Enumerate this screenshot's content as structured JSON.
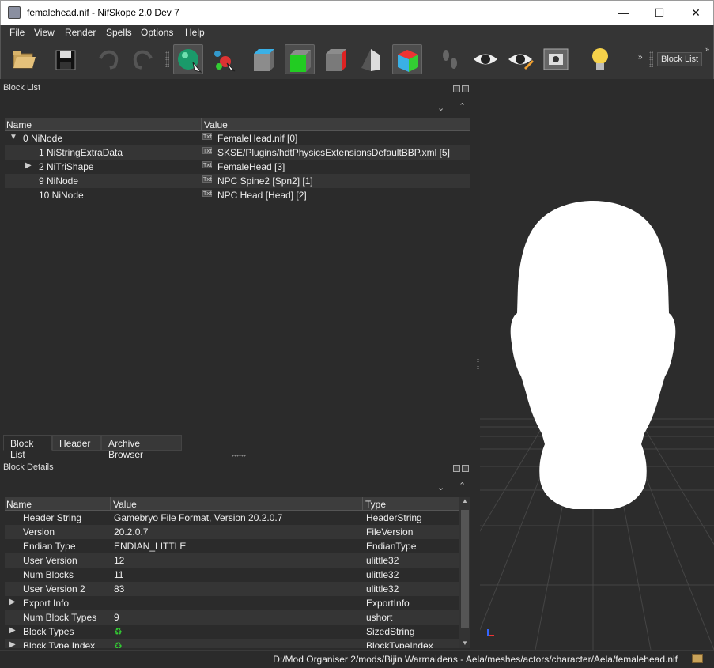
{
  "window": {
    "title": "femalehead.nif - NifSkope 2.0 Dev 7",
    "minimize_glyph": "—",
    "maximize_glyph": "☐",
    "close_glyph": "✕"
  },
  "menu": [
    "File",
    "View",
    "Render",
    "Spells",
    "Options",
    "Help"
  ],
  "toolbar": {
    "overflow_glyph": "»",
    "block_list_button": "Block List"
  },
  "block_list": {
    "title": "Block List",
    "columns": [
      "Name",
      "Value"
    ],
    "rows": [
      {
        "name": "0 NiNode",
        "value": "FemaleHead.nif [0]",
        "expander": "▼"
      },
      {
        "name": "1 NiStringExtraData",
        "value": "SKSE/Plugins/hdtPhysicsExtensionsDefaultBBP.xml [5]",
        "expander": ""
      },
      {
        "name": "2 NiTriShape",
        "value": "FemaleHead [3]",
        "expander": "▶"
      },
      {
        "name": "9 NiNode",
        "value": "NPC Spine2 [Spn2] [1]",
        "expander": ""
      },
      {
        "name": "10 NiNode",
        "value": "NPC Head [Head] [2]",
        "expander": ""
      }
    ],
    "value_icon": "Txt"
  },
  "tabs": [
    "Block List",
    "Header",
    "Archive Browser"
  ],
  "block_details": {
    "title": "Block Details",
    "columns": [
      "Name",
      "Value",
      "Type"
    ],
    "rows": [
      {
        "name": "Header String",
        "value": "Gamebryo File Format, Version 20.2.0.7",
        "type": "HeaderString",
        "expander": ""
      },
      {
        "name": "Version",
        "value": "20.2.0.7",
        "type": "FileVersion",
        "expander": ""
      },
      {
        "name": "Endian Type",
        "value": "ENDIAN_LITTLE",
        "type": "EndianType",
        "expander": ""
      },
      {
        "name": "User Version",
        "value": "12",
        "type": "ulittle32",
        "expander": ""
      },
      {
        "name": "Num Blocks",
        "value": "11",
        "type": "ulittle32",
        "expander": ""
      },
      {
        "name": "User Version 2",
        "value": "83",
        "type": "ulittle32",
        "expander": ""
      },
      {
        "name": "Export Info",
        "value": "",
        "type": "ExportInfo",
        "expander": "▶"
      },
      {
        "name": "Num Block Types",
        "value": "9",
        "type": "ushort",
        "expander": ""
      },
      {
        "name": "Block Types",
        "value": "",
        "type": "SizedString",
        "expander": "▶"
      },
      {
        "name": "Block Type Index",
        "value": "",
        "type": "BlockTypeIndex",
        "expander": "▶"
      }
    ]
  },
  "status": {
    "path": "D:/Mod Organiser 2/mods/Bijin Warmaidens - Aela/meshes/actors/character/Aela/femalehead.nif"
  },
  "colors": {
    "background": "#2b2b2b",
    "head_mesh": "#ffffff",
    "grid": "#4a4a4a"
  }
}
